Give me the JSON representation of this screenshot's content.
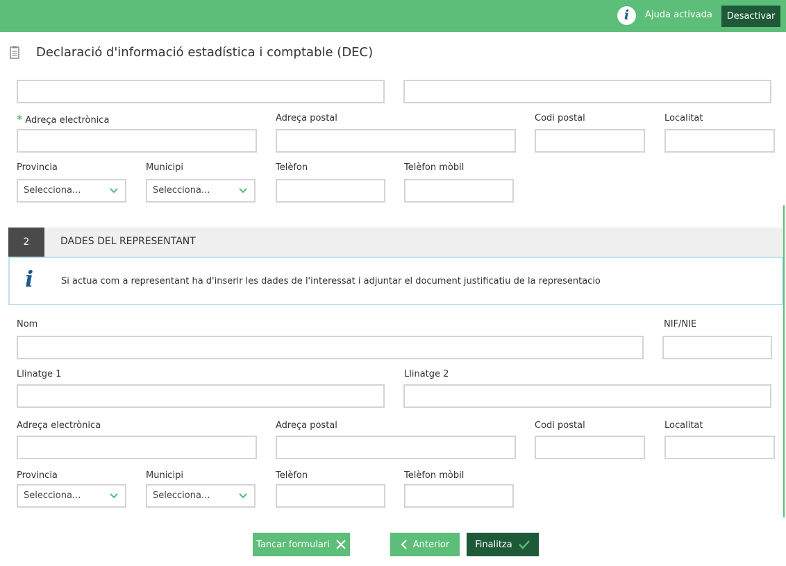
{
  "header": {
    "help_icon": "info-icon",
    "help_status": "Ajuda activada",
    "deactivate_label": "Desactivar",
    "accent_color": "#5cbe78",
    "dark_color": "#1f5a38"
  },
  "page": {
    "icon": "document-icon",
    "title": "Declaració d'informació estadística i comptable (DEC)"
  },
  "section1": {
    "labels": {
      "email": "Adreça electrònica",
      "postal_address": "Adreça postal",
      "postal_code": "Codi postal",
      "locality": "Localitat",
      "province": "Provincia",
      "municipality": "Municipi",
      "phone": "Telèfon",
      "mobile": "Telèfon mòbil"
    },
    "required_marker": "*",
    "province_value": "Selecciona...",
    "municipality_value": "Selecciona..."
  },
  "section2": {
    "number": "2",
    "title": "DADES DEL REPRESENTANT",
    "info_text": "Si actua com a representant ha d'inserir les dades de l'interessat i adjuntar el document justificatiu de la representacio",
    "labels": {
      "name": "Nom",
      "nif": "NIF/NIE",
      "surname1": "Llinatge 1",
      "surname2": "Llinatge 2",
      "email": "Adreça electrònica",
      "postal_address": "Adreça postal",
      "postal_code": "Codi postal",
      "locality": "Localitat",
      "province": "Provincia",
      "municipality": "Municipi",
      "phone": "Telèfon",
      "mobile": "Telèfon mòbil"
    },
    "province_value": "Selecciona...",
    "municipality_value": "Selecciona..."
  },
  "footer": {
    "close_label": "Tancar formulari",
    "prev_label": "Anterior",
    "finish_label": "Finalitza"
  }
}
